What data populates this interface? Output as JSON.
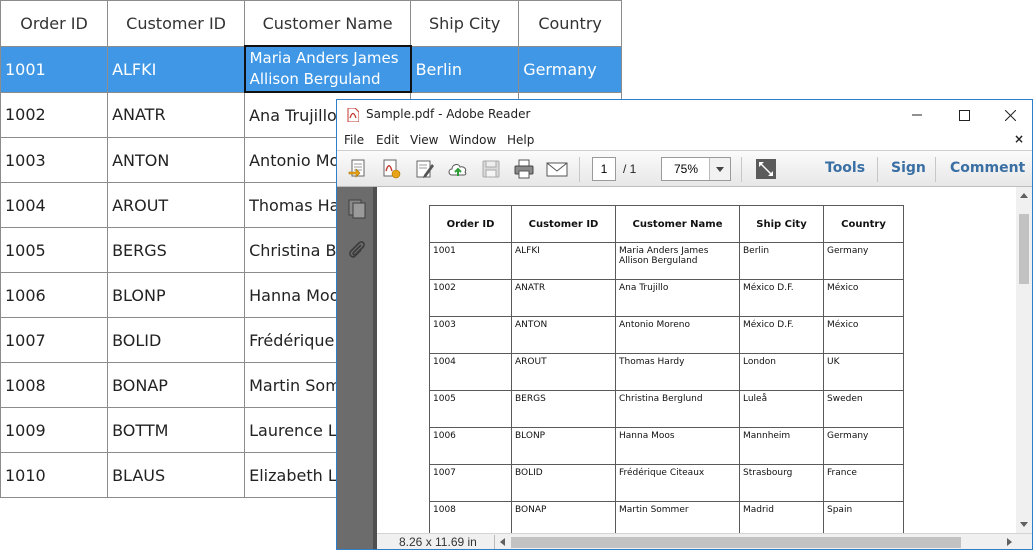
{
  "grid": {
    "headers": [
      "Order ID",
      "Customer ID",
      "Customer Name",
      "Ship City",
      "Country"
    ],
    "rows": [
      [
        "1001",
        "ALFKI",
        "Maria Anders James Allison Berguland",
        "Berlin",
        "Germany"
      ],
      [
        "1002",
        "ANATR",
        "Ana Trujillo",
        "",
        ""
      ],
      [
        "1003",
        "ANTON",
        "Antonio Moreno",
        "",
        ""
      ],
      [
        "1004",
        "AROUT",
        "Thomas Hardy",
        "",
        ""
      ],
      [
        "1005",
        "BERGS",
        "Christina Berglund",
        "",
        ""
      ],
      [
        "1006",
        "BLONP",
        "Hanna Moos",
        "",
        ""
      ],
      [
        "1007",
        "BOLID",
        "Frédérique Citeaux",
        "",
        ""
      ],
      [
        "1008",
        "BONAP",
        "Martin Sommer",
        "",
        ""
      ],
      [
        "1009",
        "BOTTM",
        "Laurence Lebihan",
        "",
        ""
      ],
      [
        "1010",
        "BLAUS",
        "Elizabeth Lincoln",
        "",
        ""
      ]
    ],
    "selected_color": "#3f97e6"
  },
  "reader": {
    "title": "Sample.pdf - Adobe Reader",
    "menu": [
      "File",
      "Edit",
      "View",
      "Window",
      "Help"
    ],
    "close_doc": "×",
    "page_current": "1",
    "page_total": "/ 1",
    "zoom": "75%",
    "links": [
      "Tools",
      "Sign",
      "Comment"
    ],
    "page_size": "8.26 x 11.69 in",
    "accent": "#3a6fa4"
  },
  "pdf": {
    "headers": [
      "Order ID",
      "Customer ID",
      "Customer Name",
      "Ship City",
      "Country"
    ],
    "rows": [
      [
        "1001",
        "ALFKI",
        "Maria Anders James Allison Berguland",
        "Berlin",
        "Germany"
      ],
      [
        "1002",
        "ANATR",
        "Ana Trujillo",
        "México D.F.",
        "México"
      ],
      [
        "1003",
        "ANTON",
        "Antonio Moreno",
        "México D.F.",
        "México"
      ],
      [
        "1004",
        "AROUT",
        "Thomas Hardy",
        "London",
        "UK"
      ],
      [
        "1005",
        "BERGS",
        "Christina Berglund",
        "Luleå",
        "Sweden"
      ],
      [
        "1006",
        "BLONP",
        "Hanna Moos",
        "Mannheim",
        "Germany"
      ],
      [
        "1007",
        "BOLID",
        "Frédérique Citeaux",
        "Strasbourg",
        "France"
      ],
      [
        "1008",
        "BONAP",
        "Martin Sommer",
        "Madrid",
        "Spain"
      ]
    ]
  }
}
